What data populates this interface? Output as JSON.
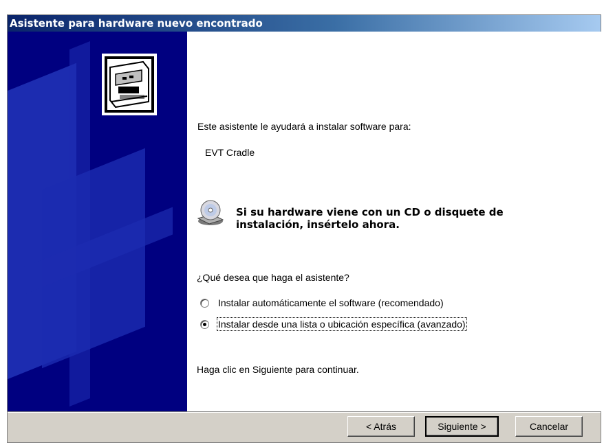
{
  "window": {
    "title": "Asistente para hardware nuevo encontrado"
  },
  "content": {
    "intro": "Este asistente le ayudará a instalar software para:",
    "device_name": "EVT  Cradle",
    "cd_prompt_line1": "Si su hardware viene con un CD o disquete de",
    "cd_prompt_line2": "instalación, insértelo ahora.",
    "question": "¿Qué desea que haga el asistente?",
    "options": [
      {
        "label": "Instalar automáticamente el software (recomendado)",
        "selected": false
      },
      {
        "label": "Instalar desde una lista o ubicación específica (avanzado)",
        "selected": true
      }
    ],
    "continue_hint": "Haga clic en Siguiente para continuar."
  },
  "buttons": {
    "back": "< Atrás",
    "next": "Siguiente >",
    "cancel": "Cancelar"
  },
  "icons": {
    "wizard_graphic": "hardware-card-icon",
    "cd_icon": "cd-drive-icon"
  },
  "colors": {
    "left_panel": "#000080",
    "titlebar_start": "#0a246a",
    "titlebar_end": "#a6caf0"
  }
}
